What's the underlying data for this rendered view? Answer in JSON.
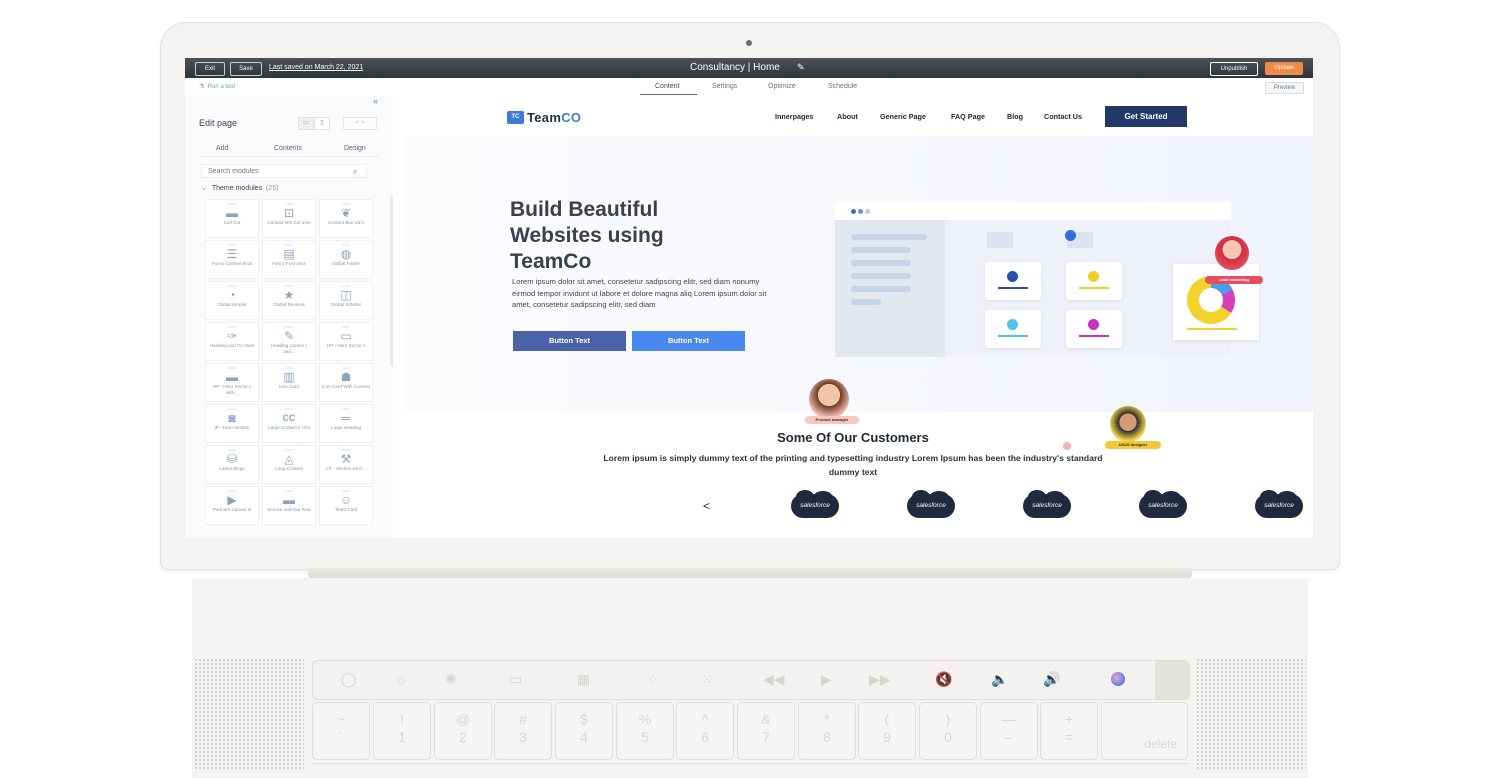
{
  "editor": {
    "exit": "Exit",
    "save": "Save",
    "last_saved": "Last saved on March 22, 2021",
    "page_title": "Consultancy | Home",
    "unpublish": "Unpublish",
    "update": "Update",
    "run_text": "Run a test",
    "tabs": [
      "Content",
      "Settings",
      "Optimize",
      "Schedule"
    ],
    "preview": "Preview"
  },
  "panel": {
    "title": "Edit page",
    "tabs": [
      "Add",
      "Contents",
      "Design"
    ],
    "search_placeholder": "Search modules",
    "theme_modules_label": "Theme modules",
    "theme_modules_count": "(25)",
    "modules": [
      {
        "label": "Call Out",
        "icon": "chat-icon"
      },
      {
        "label": "Contact Info Col umn",
        "icon": "contact-icon"
      },
      {
        "label": "Content Box wit h",
        "icon": "feather-icon"
      },
      {
        "label": "Fancy Content B ox",
        "icon": "list-icon"
      },
      {
        "label": "Fancy Form Box",
        "icon": "form-icon"
      },
      {
        "label": "Global Footer",
        "icon": "globe-icon"
      },
      {
        "label": "Global Header",
        "icon": "dashboard-icon"
      },
      {
        "label": "Global Reviews",
        "icon": "star-icon"
      },
      {
        "label": "Global Sidebar",
        "icon": "sidebar-icon"
      },
      {
        "label": "Heading and Co ntent",
        "icon": "pen-icon"
      },
      {
        "label": "Heading Conten t and...",
        "icon": "edit-icon"
      },
      {
        "label": "HP - Hero Sectio n",
        "icon": "window-icon"
      },
      {
        "label": "HP - Hero Sectio n with...",
        "icon": "banner-icon"
      },
      {
        "label": "Icon Card",
        "icon": "book-icon"
      },
      {
        "label": "Icon Card With Content",
        "icon": "reader-icon"
      },
      {
        "label": "IP - Hero Section",
        "icon": "camera-icon"
      },
      {
        "label": "Large Contact F orm",
        "icon": "cc-icon"
      },
      {
        "label": "Large Heading",
        "icon": "heading-icon"
      },
      {
        "label": "Latest Blogs",
        "icon": "database-icon"
      },
      {
        "label": "Long Content",
        "icon": "paint-icon"
      },
      {
        "label": "LP - Section wit h...",
        "icon": "brush-icon"
      },
      {
        "label": "Partners Carous el",
        "icon": "play-icon"
      },
      {
        "label": "Service Call Out Row",
        "icon": "row-icon"
      },
      {
        "label": "Team Card",
        "icon": "team-icon"
      }
    ]
  },
  "site": {
    "logo_box": "TC",
    "logo_team": "Team",
    "logo_co": "CO",
    "nav": [
      "Innerpages",
      "About",
      "Generic Page",
      "FAQ Page",
      "Blog",
      "Contact Us"
    ],
    "cta": "Get Started",
    "hero_title": "Build Beautiful Websites using TeamCo",
    "hero_text": "Lorem ipsum dolor sit amet, consetetur sadipscing elitr, sed diam nonumy eirmod tempor invidunt ut labore et dolore magna aliq Lorem ipsum dolor sit amet, consetetur sadipscing elitr, sed diam",
    "button_1": "Button Text",
    "button_2": "Button Text",
    "tag_lead": "Lead marketing",
    "tag_product": "Product manager",
    "tag_ui": "UI/UX designer",
    "customers_title": "Some Of Our Customers",
    "customers_text": "Lorem ipsum is simply dummy text of the printing and typesetting industry Lorem Ipsum has been the industry's standard dummy text",
    "partner_logo": "salesforce",
    "prev": "<",
    "next": ">"
  },
  "keyboard": {
    "keys": [
      {
        "top": "~",
        "bottom": "`"
      },
      {
        "top": "!",
        "bottom": "1"
      },
      {
        "top": "@",
        "bottom": "2"
      },
      {
        "top": "#",
        "bottom": "3"
      },
      {
        "top": "$",
        "bottom": "4"
      },
      {
        "top": "%",
        "bottom": "5"
      },
      {
        "top": "^",
        "bottom": "6"
      },
      {
        "top": "&",
        "bottom": "7"
      },
      {
        "top": "*",
        "bottom": "8"
      },
      {
        "top": "(",
        "bottom": "9"
      },
      {
        "top": ")",
        "bottom": "0"
      },
      {
        "top": "—",
        "bottom": "–"
      },
      {
        "top": "+",
        "bottom": "="
      }
    ],
    "delete": "delete"
  },
  "colors": {
    "accent_blue": "#3e7bd9",
    "navy": "#20386a",
    "update_orange": "#f08a4b",
    "button_1": "#4a62a8",
    "button_2": "#4a87ef"
  }
}
